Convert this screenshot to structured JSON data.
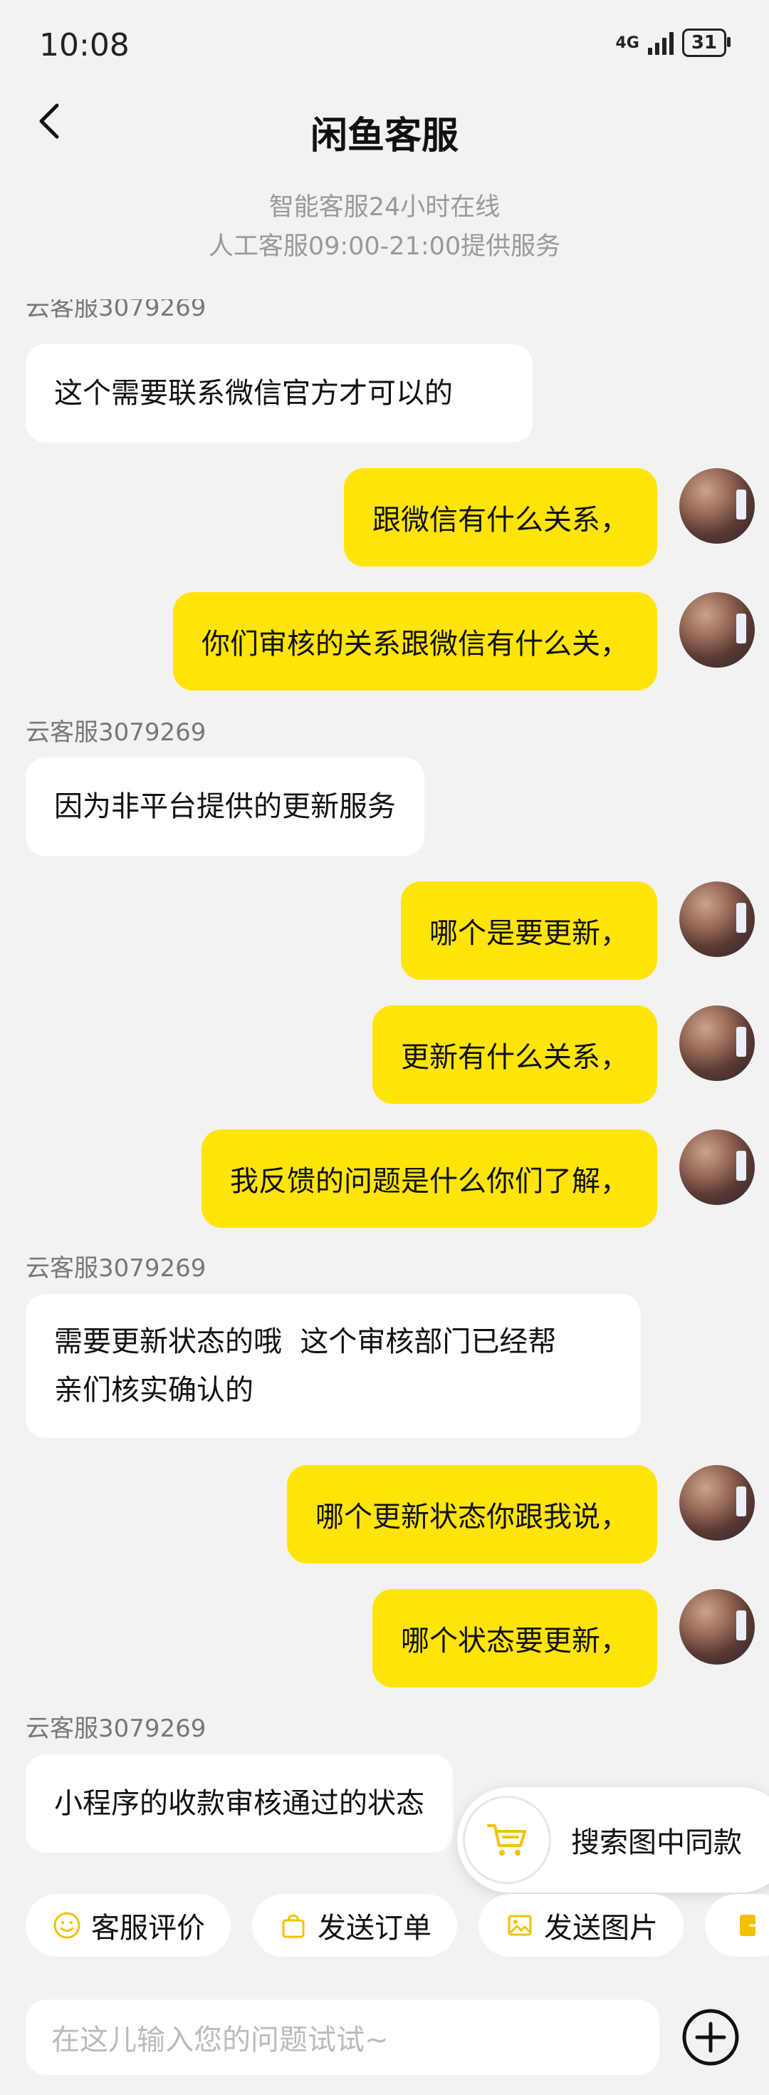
{
  "status_bar": {
    "time": "10:08",
    "network": "4G",
    "battery": "31"
  },
  "header": {
    "title": "闲鱼客服",
    "subtitle_line1": "智能客服24小时在线",
    "subtitle_line2": "人工客服09:00-21:00提供服务"
  },
  "messages": [
    {
      "side": "agent",
      "name": "云客服3079269",
      "text": "这个需要联系微信官方才可以的"
    },
    {
      "side": "user",
      "text": "跟微信有什么关系，"
    },
    {
      "side": "user",
      "text": "你们审核的关系跟微信有什么关，"
    },
    {
      "side": "agent",
      "name": "云客服3079269",
      "text": "因为非平台提供的更新服务"
    },
    {
      "side": "user",
      "text": "哪个是要更新，"
    },
    {
      "side": "user",
      "text": "更新有什么关系，"
    },
    {
      "side": "user",
      "text": "我反馈的问题是什么你们了解，"
    },
    {
      "side": "agent",
      "name": "云客服3079269",
      "line1": "需要更新状态的哦  这个审核部门已经帮",
      "line2": "亲们核实确认的"
    },
    {
      "side": "user",
      "text": "哪个更新状态你跟我说，"
    },
    {
      "side": "user",
      "text": "哪个状态要更新，"
    },
    {
      "side": "agent",
      "name": "云客服3079269",
      "text": "小程序的收款审核通过的状态"
    }
  ],
  "floating_search": {
    "label": "搜索图中同款",
    "icon": "cart-icon"
  },
  "quick_actions": [
    {
      "label": "客服评价",
      "icon": "smile-icon"
    },
    {
      "label": "发送订单",
      "icon": "bag-icon"
    },
    {
      "label": "发送图片",
      "icon": "image-icon"
    }
  ],
  "input": {
    "placeholder": "在这儿输入您的问题试试~"
  },
  "colors": {
    "accent": "#ffe40a",
    "icon_yellow": "#f2c200"
  }
}
